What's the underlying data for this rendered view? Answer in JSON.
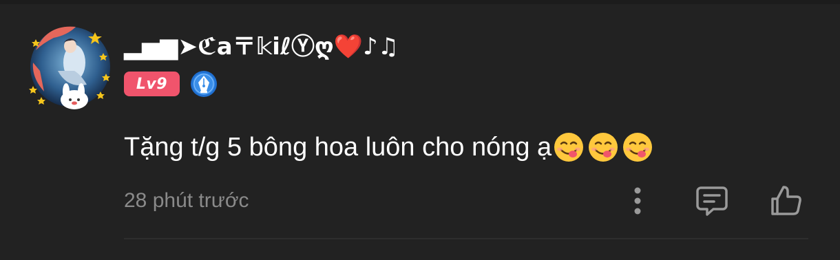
{
  "comment": {
    "username": "▂▅▆➤ℭa〒𝕜iℓⓎღ❤️♪♫",
    "level_badge": "Lv9",
    "writer_badge_icon": "pen-nib-icon",
    "text": "Tặng t/g 5 bông hoa luôn cho nóng ạ",
    "emojis": [
      "face-savoring-food-emoji",
      "face-savoring-food-emoji",
      "face-savoring-food-emoji"
    ],
    "timestamp": "28 phút trước",
    "actions": {
      "more_icon": "more-vertical-icon",
      "reply_icon": "comment-icon",
      "like_icon": "thumbs-up-icon"
    }
  },
  "colors": {
    "background": "#222222",
    "level_badge": "#f0546c",
    "writer_badge": "#3a8ee8",
    "timestamp": "#8a8a8a",
    "icon": "#9a9a9a"
  }
}
